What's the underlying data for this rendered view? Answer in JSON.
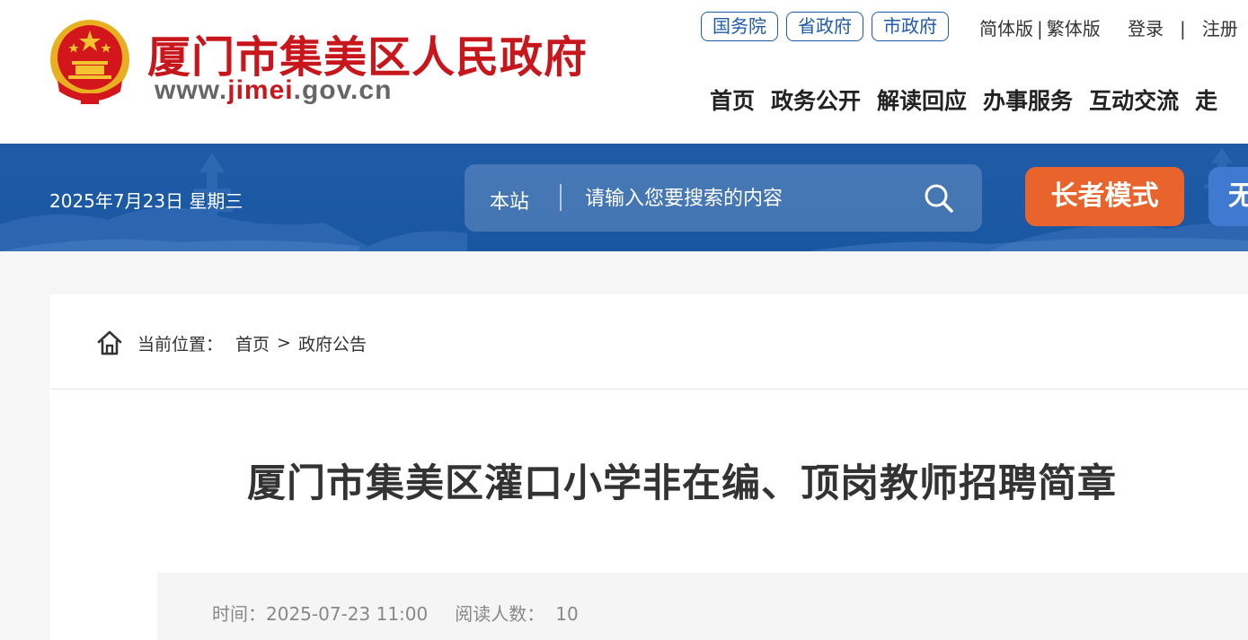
{
  "header": {
    "site_title": "厦门市集美区人民政府",
    "url_prefix": "www.",
    "url_accent": "jimei",
    "url_suffix": ".gov.cn",
    "top_links": [
      "国务院",
      "省政府",
      "市政府"
    ],
    "lang": {
      "simplified": "简体版",
      "separator": "|",
      "traditional": "繁体版"
    },
    "auth": {
      "login": "登录",
      "separator": "|",
      "register": "注册"
    },
    "nav": [
      "首页",
      "政务公开",
      "解读回应",
      "办事服务",
      "互动交流",
      "走"
    ]
  },
  "banner": {
    "date": "2025年7月23日 星期三",
    "search": {
      "scope": "本站",
      "placeholder": "请输入您要搜索的内容"
    },
    "elder_mode": "长者模式",
    "accessibility": "无"
  },
  "breadcrumb": {
    "label": "当前位置：",
    "items": [
      "首页",
      "政府公告"
    ],
    "separator": ">"
  },
  "article": {
    "title": "厦门市集美区灌口小学非在编、顶岗教师招聘简章",
    "time_label": "时间：",
    "time": "2025-07-23 11:00",
    "reads_label": "阅读人数：",
    "reads": "10"
  },
  "colors": {
    "brand_red": "#c8161d",
    "banner_blue": "#1f5ba7",
    "elder_orange": "#e8642c"
  }
}
